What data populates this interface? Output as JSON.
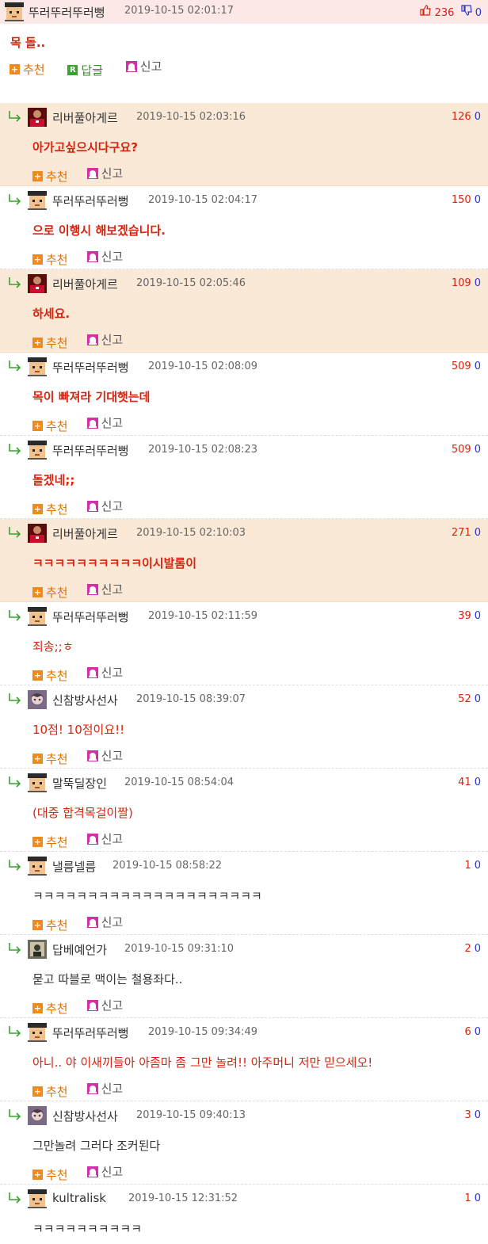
{
  "post": {
    "nick": "뚜러뚜러뚜러뻥",
    "date": "2019-10-15 02:01:17",
    "up": "236",
    "down": "0",
    "text": "목 돌..",
    "recommend_label": "추천",
    "reply_label": "답글",
    "report_label": "신고"
  },
  "comments": [
    {
      "nick": "리버풀아게르",
      "date": "2019-10-15 02:03:16",
      "up": "126",
      "down": "0",
      "text": "아가고싶으시다구요?",
      "avatar": "liverpool-player-avatar",
      "highlight": true,
      "color": "red",
      "bold": true
    },
    {
      "nick": "뚜러뚜러뚜러뻥",
      "date": "2019-10-15 02:04:17",
      "up": "150",
      "down": "0",
      "text": "으로 이행시 해보겠습니다.",
      "avatar": "pixel-person-avatar",
      "highlight": false,
      "color": "red",
      "bold": true
    },
    {
      "nick": "리버풀아게르",
      "date": "2019-10-15 02:05:46",
      "up": "109",
      "down": "0",
      "text": "하세요.",
      "avatar": "liverpool-player-avatar",
      "highlight": true,
      "color": "red",
      "bold": true
    },
    {
      "nick": "뚜러뚜러뚜러뻥",
      "date": "2019-10-15 02:08:09",
      "up": "509",
      "down": "0",
      "text": "목이 빠져라 기대햇는데",
      "avatar": "pixel-person-avatar",
      "highlight": false,
      "color": "red",
      "bold": true
    },
    {
      "nick": "뚜러뚜러뚜러뻥",
      "date": "2019-10-15 02:08:23",
      "up": "509",
      "down": "0",
      "text": "돌겠네;;",
      "avatar": "pixel-person-avatar",
      "highlight": false,
      "color": "red",
      "bold": true
    },
    {
      "nick": "리버풀아게르",
      "date": "2019-10-15 02:10:03",
      "up": "271",
      "down": "0",
      "text": "ㅋㅋㅋㅋㅋㅋㅋㅋㅋㅋ이시발롬이",
      "avatar": "liverpool-player-avatar",
      "highlight": true,
      "color": "red",
      "bold": true
    },
    {
      "nick": "뚜러뚜러뚜러뻥",
      "date": "2019-10-15 02:11:59",
      "up": "39",
      "down": "0",
      "text": "죄송;;ㅎ",
      "avatar": "pixel-person-avatar",
      "highlight": false,
      "color": "red",
      "bold": false
    },
    {
      "nick": "신참방사선사",
      "date": "2019-10-15 08:39:07",
      "up": "52",
      "down": "0",
      "text": "10점! 10점이요!!",
      "avatar": "anime-girl-avatar",
      "highlight": false,
      "color": "red",
      "bold": false
    },
    {
      "nick": "말뚝딜장인",
      "date": "2019-10-15 08:54:04",
      "up": "41",
      "down": "0",
      "text": "(대중 합격목걸이짤)",
      "avatar": "pixel-person-avatar",
      "highlight": false,
      "color": "red",
      "bold": false
    },
    {
      "nick": "낼름넬름",
      "date": "2019-10-15 08:58:22",
      "up": "1",
      "down": "0",
      "text": "ㅋㅋㅋㅋㅋㅋㅋㅋㅋㅋㅋㅋㅋㅋㅋㅋㅋㅋㅋㅋㅋ",
      "avatar": "pixel-person-avatar",
      "highlight": false,
      "color": "plain",
      "bold": false
    },
    {
      "nick": "답베예언가",
      "date": "2019-10-15 09:31:10",
      "up": "2",
      "down": "0",
      "text": "묻고 따블로 맥이는 철용좌다..",
      "avatar": "photo-avatar",
      "highlight": false,
      "color": "plain",
      "bold": false
    },
    {
      "nick": "뚜러뚜러뚜러뻥",
      "date": "2019-10-15 09:34:49",
      "up": "6",
      "down": "0",
      "text": "아니.. 야 이새끼들아 아좀마 좀 그만 놀려!! 아주머니 저만 믿으세오!",
      "avatar": "pixel-person-avatar",
      "highlight": false,
      "color": "red",
      "bold": false
    },
    {
      "nick": "신참방사선사",
      "date": "2019-10-15 09:40:13",
      "up": "3",
      "down": "0",
      "text": "그만놀려 그러다 조커된다",
      "avatar": "anime-girl-avatar",
      "highlight": false,
      "color": "plain",
      "bold": false
    },
    {
      "nick": "kultralisk",
      "date": "2019-10-15 12:31:52",
      "up": "1",
      "down": "0",
      "text": "ㅋㅋㅋㅋㅋㅋㅋㅋㅋㅋ",
      "avatar": "pixel-person-avatar",
      "highlight": false,
      "color": "plain",
      "bold": false
    }
  ],
  "comment_actions": {
    "recommend_label": "추천",
    "report_label": "신고"
  },
  "colors": {
    "highlight_bg": "#fbe9d7",
    "op_bg": "#fde8e8",
    "accent_red": "#d9230f",
    "down_blue": "#2b33d6"
  }
}
